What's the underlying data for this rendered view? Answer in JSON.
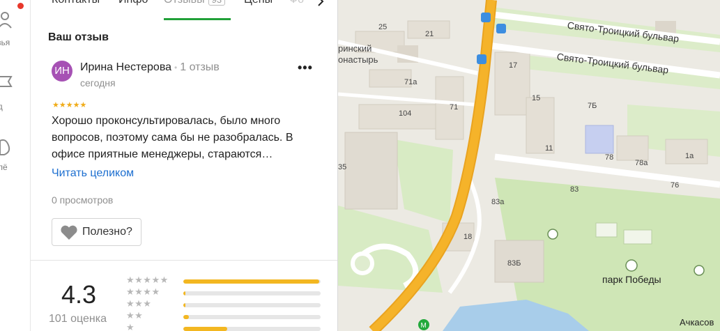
{
  "rail": {
    "items": [
      {
        "icon": "friends-icon",
        "label": "узья"
      },
      {
        "icon": "guide-icon",
        "label": "ид"
      },
      {
        "icon": "collections-icon",
        "label": "ллё"
      }
    ]
  },
  "tabs": [
    {
      "label": "Контакты"
    },
    {
      "label": "Инфо"
    },
    {
      "label": "Отзывы",
      "badge": "93",
      "active": true
    },
    {
      "label": "Цены"
    },
    {
      "label": "Фо"
    }
  ],
  "review": {
    "section_title": "Ваш отзыв",
    "avatar_initials": "ИН",
    "author": "Ирина Нестерова",
    "author_reviews": "1 отзыв",
    "date": "сегодня",
    "stars": "★★★★★",
    "text": "Хорошо проконсультировалась, было много вопросов, поэтому сама бы не разобралась. В офисе приятные менеджеры, стараются…",
    "read_more": "Читать целиком",
    "views": "0 просмотров",
    "useful_label": "Полезно?",
    "more_menu": "•••"
  },
  "rating": {
    "value": "4.3",
    "count_label": "101 оценка",
    "distribution": [
      {
        "stars": "★★★★★",
        "fraction": 0.99
      },
      {
        "stars": "★★★★",
        "fraction": 0.01
      },
      {
        "stars": "★★★",
        "fraction": 0.01
      },
      {
        "stars": "★★",
        "fraction": 0.04
      },
      {
        "stars": "★",
        "fraction": 0.32
      }
    ]
  },
  "map": {
    "colors": {
      "road_major": "#f5b32a",
      "park": "#cfe6b6",
      "water": "#a8cdea",
      "building": "#e4dfd5",
      "metro": "#23a93c"
    },
    "labels": {
      "monastery_line1": "ринский",
      "monastery_line2": "онастырь",
      "b25": "25",
      "b21": "21",
      "b71a": "71а",
      "b104": "104",
      "b71": "71",
      "b17": "17",
      "b15": "15",
      "b7b": "7Б",
      "b11": "11",
      "b78": "78",
      "b78a": "78а",
      "b1a": "1а",
      "b83": "83",
      "b76": "76",
      "b83a": "83а",
      "b18": "18",
      "b83b": "83Б",
      "b35": "35",
      "street1": "Свято-Троицкий бульвар",
      "street2": "Свято-Троицкий бульвар",
      "park": "парк Победы",
      "achkasova": "Ачкасов"
    }
  }
}
